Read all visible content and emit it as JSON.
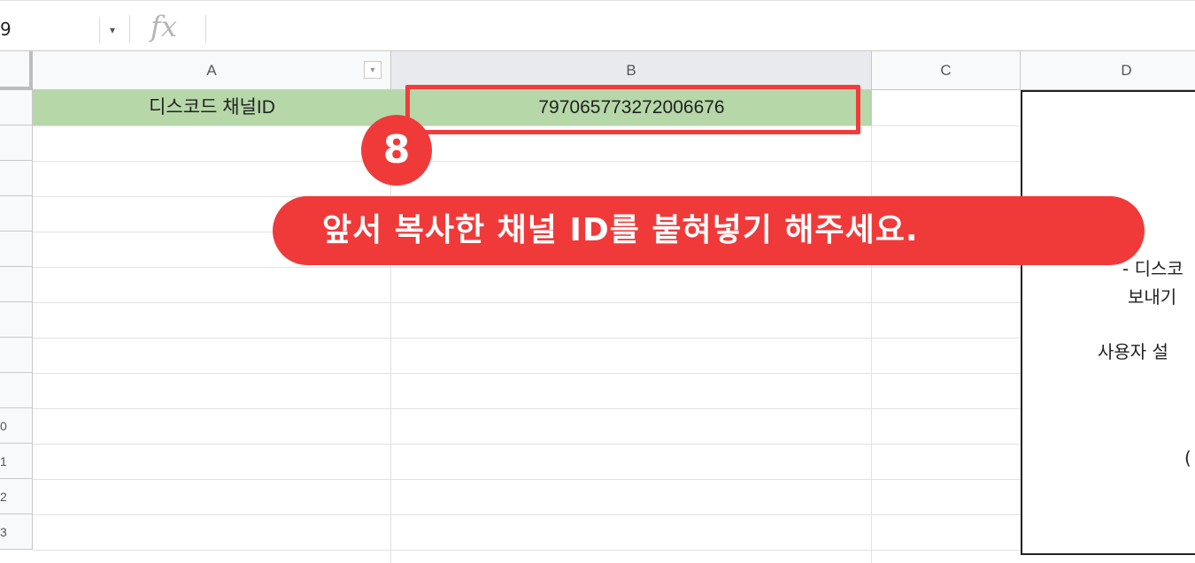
{
  "formula_bar": {
    "name_box": "9",
    "name_dropdown_icon": "caret-down-icon",
    "fx_label": "fx"
  },
  "columns": [
    "A",
    "B",
    "C",
    "D"
  ],
  "rows": [
    "",
    "",
    "",
    "",
    "",
    "",
    "",
    "",
    "",
    "0",
    "1",
    "2",
    "3"
  ],
  "cells": {
    "A1": "디스코드 채널ID",
    "B1": "797065773272006676"
  },
  "annotation": {
    "step_number": "8",
    "callout_text": "앞서 복사한 채널 ID를 붙혀넣기 해주세요.",
    "accent_color": "#f03a3a"
  },
  "side_panel": {
    "lines": [
      "- 디스코",
      "보내기",
      "",
      "사용자 설",
      "("
    ]
  },
  "colors": {
    "header_cell_fill": "#b6d7a8",
    "grid": "#e2e2e2"
  }
}
